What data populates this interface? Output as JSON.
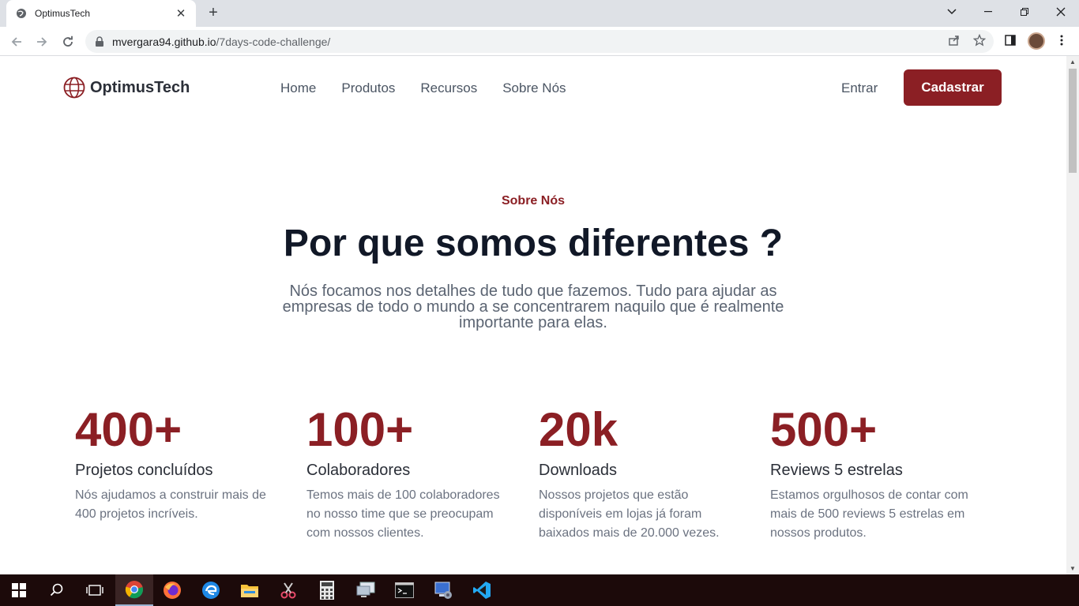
{
  "browser": {
    "tab_title": "OptimusTech",
    "url_host": "mvergara94.github.io",
    "url_path": "/7days-code-challenge/"
  },
  "nav": {
    "brand": "OptimusTech",
    "links": [
      "Home",
      "Produtos",
      "Recursos",
      "Sobre Nós"
    ],
    "login": "Entrar",
    "signup": "Cadastrar"
  },
  "hero": {
    "eyebrow": "Sobre Nós",
    "title": "Por que somos diferentes ?",
    "lede": "Nós focamos nos detalhes de tudo que fazemos. Tudo para ajudar as empresas de todo o mundo a se concentrarem naquilo que é realmente importante para elas."
  },
  "stats": [
    {
      "value": "400+",
      "label": "Projetos concluídos",
      "desc": "Nós ajudamos a construir mais de 400 projetos incríveis."
    },
    {
      "value": "100+",
      "label": "Colaboradores",
      "desc": "Temos mais de 100 colaboradores no nosso time que se preocupam com nossos clientes."
    },
    {
      "value": "20k",
      "label": "Downloads",
      "desc": "Nossos projetos que estão disponíveis em lojas já foram baixados mais de 20.000 vezes."
    },
    {
      "value": "500+",
      "label": "Reviews 5 estrelas",
      "desc": "Estamos orgulhosos de contar com mais de 500 reviews 5 estrelas em nossos produtos."
    }
  ],
  "colors": {
    "accent": "#8b1f24",
    "heading": "#111827",
    "body_text": "#5b6472"
  },
  "taskbar_icons": [
    "windows-start-icon",
    "search-icon",
    "task-view-icon",
    "chrome-icon",
    "firefox-icon",
    "edge-icon",
    "file-explorer-icon",
    "snipping-tool-icon",
    "calculator-icon",
    "remote-desktop-icon",
    "terminal-icon",
    "system-manager-icon",
    "vscode-icon"
  ]
}
